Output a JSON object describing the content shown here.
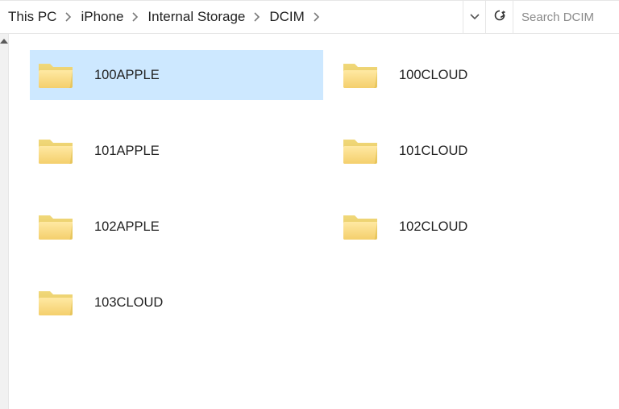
{
  "breadcrumb": {
    "items": [
      {
        "label": "This PC"
      },
      {
        "label": "iPhone"
      },
      {
        "label": "Internal Storage"
      },
      {
        "label": "DCIM"
      }
    ]
  },
  "toolbar": {
    "history_icon": "chevron-down",
    "refresh_icon": "refresh"
  },
  "search": {
    "placeholder": "Search DCIM",
    "value": ""
  },
  "folders": {
    "items": [
      {
        "name": "100APPLE",
        "selected": true
      },
      {
        "name": "100CLOUD",
        "selected": false
      },
      {
        "name": "101APPLE",
        "selected": false
      },
      {
        "name": "101CLOUD",
        "selected": false
      },
      {
        "name": "102APPLE",
        "selected": false
      },
      {
        "name": "102CLOUD",
        "selected": false
      },
      {
        "name": "103CLOUD",
        "selected": false
      }
    ],
    "columns": 2
  }
}
